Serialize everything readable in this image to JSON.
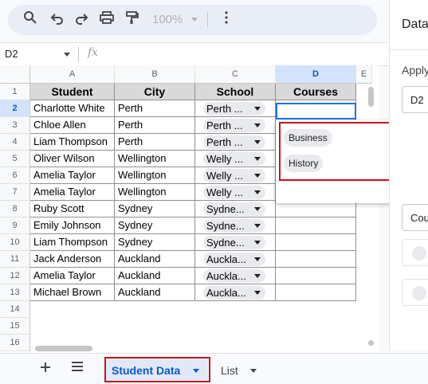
{
  "toolbar": {
    "icons": [
      "search-icon",
      "undo-icon",
      "redo-icon",
      "print-icon",
      "paint-format-icon",
      "more-vert-icon"
    ],
    "zoom": "100%"
  },
  "formula_bar": {
    "name_box": "D2",
    "fx_label": "fx"
  },
  "grid": {
    "columns": [
      "A",
      "B",
      "C",
      "D",
      "E"
    ],
    "rows": [
      "1",
      "2",
      "3",
      "4",
      "5",
      "6",
      "7",
      "8",
      "9",
      "10",
      "11",
      "12",
      "13",
      "14",
      "15",
      "16"
    ],
    "headers": {
      "student": "Student",
      "city": "City",
      "school": "School",
      "courses": "Courses"
    },
    "data": [
      {
        "student": "Charlotte White",
        "city": "Perth",
        "school": "Perth ..."
      },
      {
        "student": "Chloe Allen",
        "city": "Perth",
        "school": "Perth ..."
      },
      {
        "student": "Liam Thompson",
        "city": "Perth",
        "school": "Perth ..."
      },
      {
        "student": "Oliver Wilson",
        "city": "Wellington",
        "school": "Welly ..."
      },
      {
        "student": "Amelia Taylor",
        "city": "Wellington",
        "school": "Welly ..."
      },
      {
        "student": "Amelia Taylor",
        "city": "Wellington",
        "school": "Welly ..."
      },
      {
        "student": "Ruby Scott",
        "city": "Sydney",
        "school": "Sydne..."
      },
      {
        "student": "Emily Johnson",
        "city": "Sydney",
        "school": "Sydne..."
      },
      {
        "student": "Liam Thompson",
        "city": "Sydney",
        "school": "Sydne..."
      },
      {
        "student": "Jack Anderson",
        "city": "Auckland",
        "school": "Auckla..."
      },
      {
        "student": "Amelia Taylor",
        "city": "Auckland",
        "school": "Auckla..."
      },
      {
        "student": "Michael Brown",
        "city": "Auckland",
        "school": "Auckla..."
      }
    ]
  },
  "dropdown": {
    "options": [
      "Business",
      "History"
    ],
    "edit_icon": "pencil-icon"
  },
  "side_panel": {
    "title": "Data",
    "apply_label": "Apply",
    "range_value": "D2",
    "criteria_value": "Cou"
  },
  "sheet_tabs": {
    "active": "Student Data",
    "other": "List"
  },
  "colors": {
    "selection": "#1a73e8",
    "highlight_red": "#c0181f",
    "active_tab": "#0b57d0"
  }
}
